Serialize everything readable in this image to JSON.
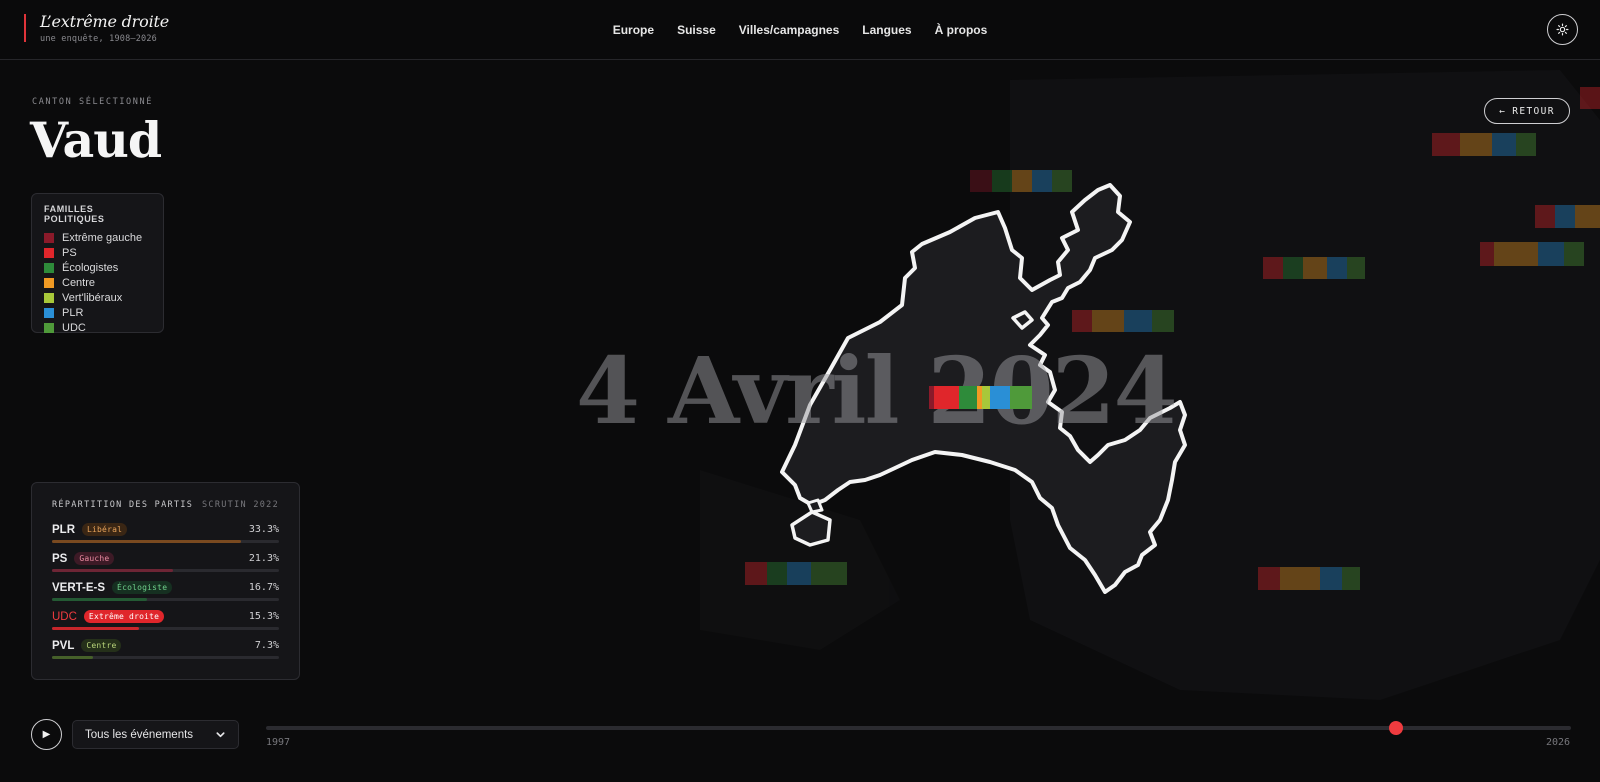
{
  "brand": {
    "title": "L’extrême droite",
    "subtitle": "une enquête, 1908–2026"
  },
  "nav": {
    "items": [
      "Europe",
      "Suisse",
      "Villes/campagnes",
      "Langues",
      "À propos"
    ]
  },
  "theme_toggle": {
    "icon": "sun-icon"
  },
  "canton": {
    "label": "CANTON SÉLECTIONNÉ",
    "name": "Vaud"
  },
  "back_button": {
    "arrow": "←",
    "label": "RETOUR"
  },
  "legend": {
    "title": "FAMILLES POLITIQUES",
    "items": [
      {
        "label": "Extrême gauche",
        "color": "#8b1a2a"
      },
      {
        "label": "PS",
        "color": "#e0262b"
      },
      {
        "label": "Écologistes",
        "color": "#2e8b3a"
      },
      {
        "label": "Centre",
        "color": "#f09a24"
      },
      {
        "label": "Vert'libéraux",
        "color": "#a8c83a"
      },
      {
        "label": "PLR",
        "color": "#2a8fd6"
      },
      {
        "label": "UDC",
        "color": "#4f9a3a"
      }
    ]
  },
  "map": {
    "date": "4 Avril 2024"
  },
  "parties": {
    "title": "RÉPARTITION DES PARTIS",
    "scrutin": "SCRUTIN 2022",
    "rows": [
      {
        "name": "PLR",
        "badge": "Libéral",
        "percent_label": "33.3%",
        "value": 33.3,
        "badge_bg": "#3a2614",
        "badge_fg": "#e8a35a",
        "bar": "#7a4a20",
        "highlight": false
      },
      {
        "name": "PS",
        "badge": "Gauche",
        "percent_label": "21.3%",
        "value": 21.3,
        "badge_bg": "#3d1a26",
        "badge_fg": "#e88aa0",
        "bar": "#6e2535",
        "highlight": false
      },
      {
        "name": "VERT-E-S",
        "badge": "Écologiste",
        "percent_label": "16.7%",
        "value": 16.7,
        "badge_bg": "#163021",
        "badge_fg": "#6fcf8a",
        "bar": "#245a34",
        "highlight": false
      },
      {
        "name": "UDC",
        "badge": "Extrême droite",
        "percent_label": "15.3%",
        "value": 15.3,
        "badge_bg": "#e0262b",
        "badge_fg": "#ffffff",
        "bar": "#c8262b",
        "highlight": true
      },
      {
        "name": "PVL",
        "badge": "Centre",
        "percent_label": "7.3%",
        "value": 7.3,
        "badge_bg": "#25301a",
        "badge_fg": "#b8d47a",
        "bar": "#46602a",
        "highlight": false
      }
    ]
  },
  "timeline": {
    "play_icon": "▶",
    "filter": {
      "selected": "Tous les événements"
    },
    "start_label": "1997",
    "end_label": "2026",
    "start_year": 1997,
    "end_year": 2026,
    "current_year": 2022.1
  }
}
